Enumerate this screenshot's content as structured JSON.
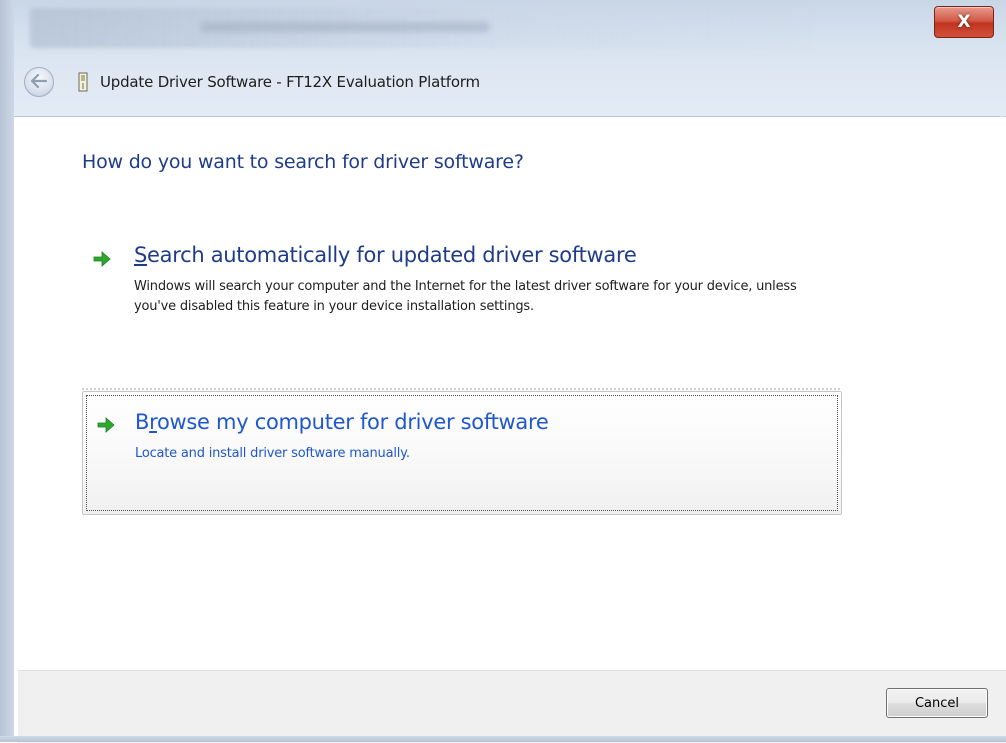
{
  "window": {
    "title": "Update Driver Software - FT12X Evaluation Platform",
    "close_glyph": "X"
  },
  "icons": {
    "back": "back-arrow-icon",
    "device": "usb-device-icon",
    "option_arrow": "green-arrow-icon"
  },
  "colors": {
    "heading": "#1f3c8a",
    "link_hover": "#1f57cf",
    "arrow": "#2fa82f",
    "close_button": "#c1331f"
  },
  "main": {
    "question": "How do you want to search for driver software?",
    "options": [
      {
        "mnemonic": "S",
        "title_rest": "earch automatically for updated driver software",
        "description": "Windows will search your computer and the Internet for the latest driver software for your device, unless you've disabled this feature in your device installation settings."
      },
      {
        "title_pre": "B",
        "mnemonic": "r",
        "title_rest": "owse my computer for driver software",
        "description": "Locate and install driver software manually."
      }
    ]
  },
  "footer": {
    "cancel_label": "Cancel"
  }
}
